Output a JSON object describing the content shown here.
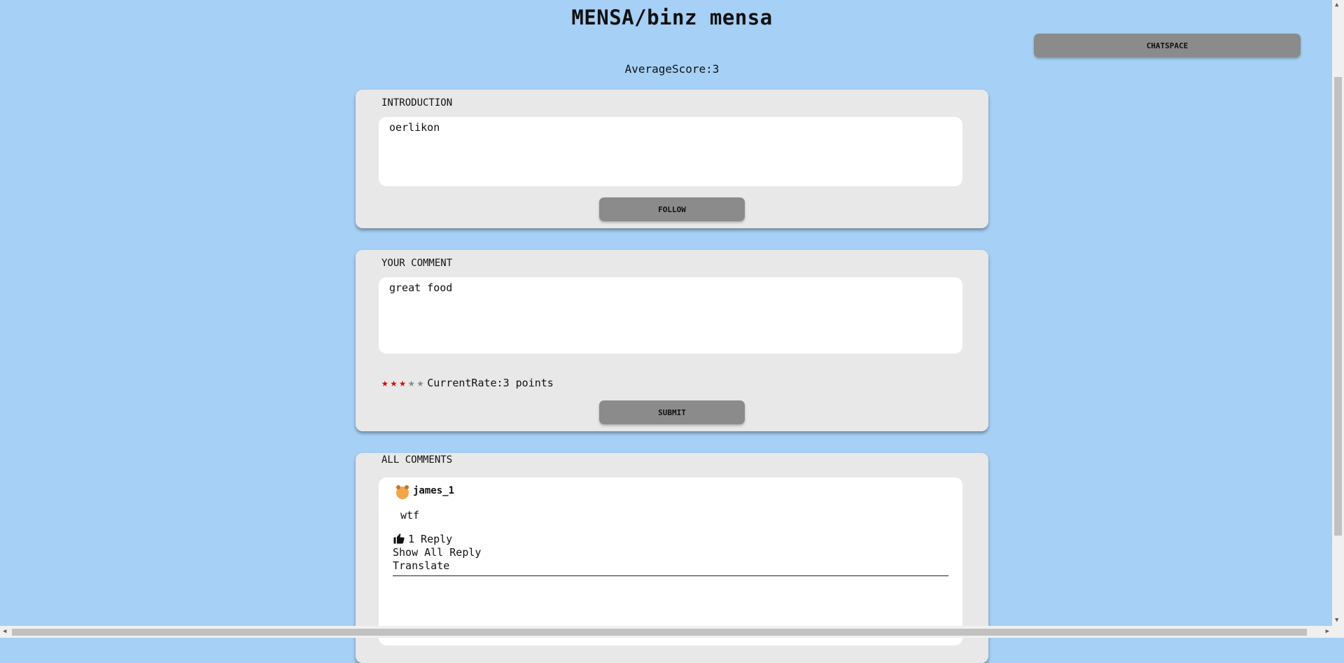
{
  "page": {
    "title": "MENSA/binz mensa",
    "average_score": "AverageScore:3"
  },
  "header": {
    "chatspace_label": "CHATSPACE"
  },
  "introduction": {
    "label": "INTRODUCTION",
    "text": "oerlikon",
    "follow_label": "FOLLOW"
  },
  "your_comment": {
    "label": "YOUR COMMENT",
    "text": "great food",
    "rating": {
      "value": 3,
      "max": 5,
      "label": "CurrentRate:3 points"
    },
    "submit_label": "SUBMIT"
  },
  "all_comments": {
    "label": "ALL COMMENTS",
    "items": [
      {
        "author": "james_1",
        "avatar_icon": "bear-icon",
        "text": "wtf",
        "reply_count_label": "1 Reply",
        "show_all_label": "Show All Reply",
        "translate_label": "Translate"
      }
    ]
  },
  "colors": {
    "background": "#a6d0f5",
    "card": "#e8e8e8",
    "button": "#8b8b8b",
    "star_active": "#e00000",
    "star_inactive": "#888888"
  }
}
